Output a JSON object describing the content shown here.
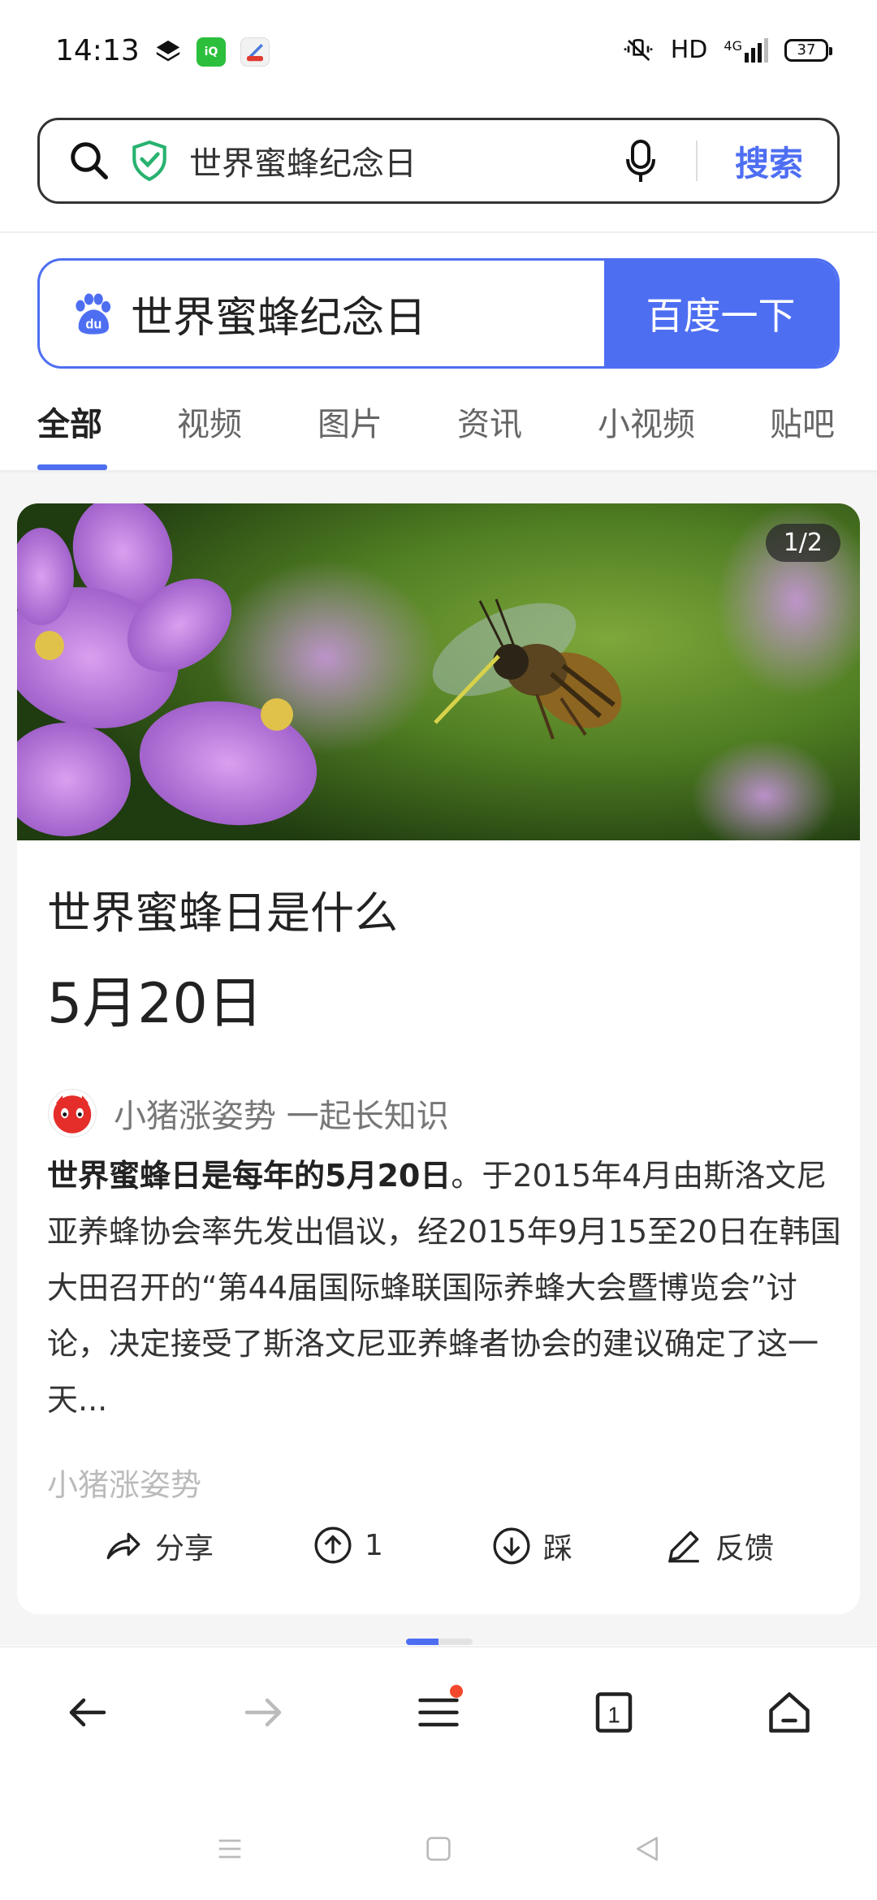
{
  "status": {
    "time": "14:13",
    "network": "HD",
    "signal": "4G",
    "battery": "37"
  },
  "top_search": {
    "query": "世界蜜蜂纪念日",
    "button": "搜索"
  },
  "baidu": {
    "query": "世界蜜蜂纪念日",
    "button": "百度一下"
  },
  "tabs": [
    {
      "label": "全部",
      "active": true
    },
    {
      "label": "视频"
    },
    {
      "label": "图片"
    },
    {
      "label": "资讯"
    },
    {
      "label": "小视频"
    },
    {
      "label": "贴吧"
    }
  ],
  "card": {
    "image_counter": "1/2",
    "title": "世界蜜蜂日是什么",
    "answer": "5月20日",
    "source": "小猪涨姿势 一起长知识",
    "snippet_bold": "世界蜜蜂日是每年的5月20日",
    "snippet_rest": "。于2015年4月由斯洛文尼亚养蜂协会率先发出倡议，经2015年9月15至20日在韩国大田召开的“第44届国际蜂联国际养蜂大会暨博览会”讨论，决定接受了斯洛文尼亚养蜂者协会的建议确定了这一天...",
    "footer_source": "小猪涨姿势",
    "actions": {
      "share": "分享",
      "upvote_count": "1",
      "downvote": "踩",
      "feedback": "反馈"
    }
  },
  "colors": {
    "accent": "#4e6ef2",
    "badge_dot": "#f3482c"
  }
}
